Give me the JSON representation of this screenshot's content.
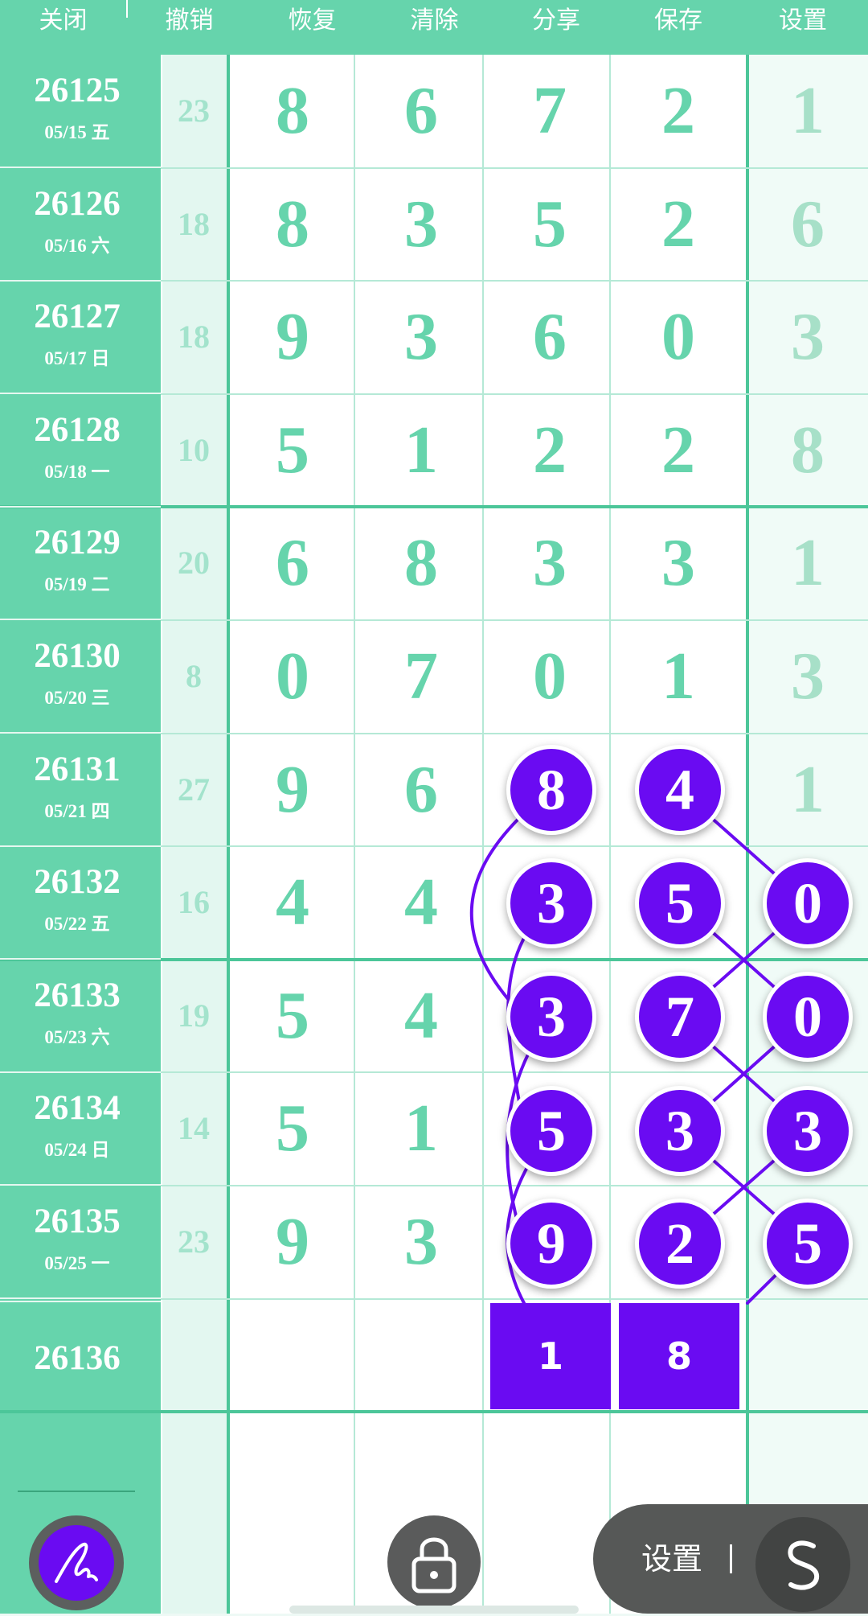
{
  "toolbar": {
    "items": [
      "关闭",
      "撤销",
      "恢复",
      "清除",
      "分享",
      "保存",
      "设置"
    ]
  },
  "rows": [
    {
      "issue": "26125",
      "date": "05/15 五",
      "sum": "23",
      "digits": [
        "8",
        "6",
        "7",
        "2",
        "1"
      ]
    },
    {
      "issue": "26126",
      "date": "05/16 六",
      "sum": "18",
      "digits": [
        "8",
        "3",
        "5",
        "2",
        "6"
      ]
    },
    {
      "issue": "26127",
      "date": "05/17 日",
      "sum": "18",
      "digits": [
        "9",
        "3",
        "6",
        "0",
        "3"
      ]
    },
    {
      "issue": "26128",
      "date": "05/18 一",
      "sum": "10",
      "digits": [
        "5",
        "1",
        "2",
        "2",
        "8"
      ]
    },
    {
      "issue": "26129",
      "date": "05/19 二",
      "sum": "20",
      "digits": [
        "6",
        "8",
        "3",
        "3",
        "1"
      ]
    },
    {
      "issue": "26130",
      "date": "05/20 三",
      "sum": "8",
      "digits": [
        "0",
        "7",
        "0",
        "1",
        "3"
      ]
    },
    {
      "issue": "26131",
      "date": "05/21 四",
      "sum": "27",
      "digits": [
        "9",
        "6",
        "8",
        "4",
        "1"
      ]
    },
    {
      "issue": "26132",
      "date": "05/22 五",
      "sum": "16",
      "digits": [
        "4",
        "4",
        "3",
        "5",
        "0"
      ]
    },
    {
      "issue": "26133",
      "date": "05/23 六",
      "sum": "19",
      "digits": [
        "5",
        "4",
        "3",
        "7",
        "0"
      ]
    },
    {
      "issue": "26134",
      "date": "05/24 日",
      "sum": "14",
      "digits": [
        "5",
        "1",
        "5",
        "3",
        "3"
      ]
    },
    {
      "issue": "26135",
      "date": "05/25 一",
      "sum": "23",
      "digits": [
        "9",
        "3",
        "9",
        "2",
        "5"
      ]
    }
  ],
  "next_issue": "26136",
  "predictions": [
    "1",
    "8"
  ],
  "controls": {
    "settings_label": "设置",
    "pen_icon": "pen-icon",
    "lock_icon": "lock-icon",
    "s_icon": "s-curve-icon"
  },
  "colors": {
    "accent_green": "#66d4ac",
    "highlight_purple": "#6a0bf2"
  }
}
